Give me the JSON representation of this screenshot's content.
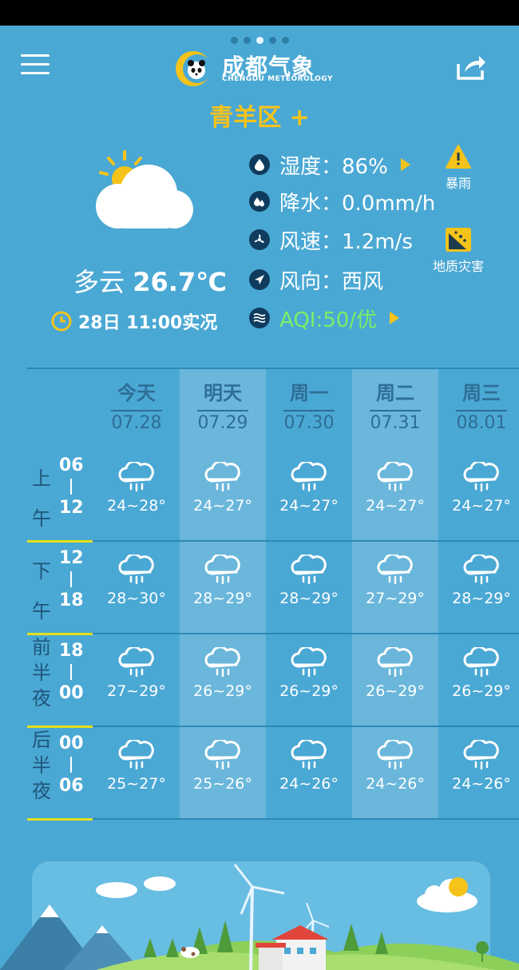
{
  "app": {
    "title": "成都气象",
    "subtitle": "CHENGDU METEOROLOGY"
  },
  "location": {
    "district": "青羊区 +"
  },
  "current": {
    "condition": "多云",
    "temperature": "26.7℃",
    "observed": "28日 11:00实况",
    "humidity": "湿度：86%",
    "precip": "降水：0.0mm/h",
    "wind_speed": "风速：1.2m/s",
    "wind_dir": "风向：西风",
    "aqi": "AQI:50/优"
  },
  "alerts": [
    {
      "label": "暴雨",
      "icon": "warning-icon",
      "color": "#f6c31a"
    },
    {
      "label": "地质灾害",
      "icon": "landslide-icon",
      "color": "#f6c31a"
    }
  ],
  "days": [
    {
      "name": "今天",
      "date": "07.28"
    },
    {
      "name": "明天",
      "date": "07.29"
    },
    {
      "name": "周一",
      "date": "07.30"
    },
    {
      "name": "周二",
      "date": "07.31"
    },
    {
      "name": "周三",
      "date": "08.01"
    }
  ],
  "periods": [
    {
      "label": [
        "上",
        "午"
      ],
      "start": "06",
      "end": "12",
      "temps": [
        "24~28°",
        "24~27°",
        "24~27°",
        "24~27°",
        "24~27°"
      ]
    },
    {
      "label": [
        "下",
        "午"
      ],
      "start": "12",
      "end": "18",
      "temps": [
        "28~30°",
        "28~29°",
        "28~29°",
        "27~29°",
        "28~29°"
      ]
    },
    {
      "label": [
        "前",
        "半",
        "夜"
      ],
      "start": "18",
      "end": "00",
      "temps": [
        "27~29°",
        "26~29°",
        "26~29°",
        "26~29°",
        "26~29°"
      ]
    },
    {
      "label": [
        "后",
        "半",
        "夜"
      ],
      "start": "00",
      "end": "06",
      "temps": [
        "25~27°",
        "25~26°",
        "24~26°",
        "24~26°",
        "24~26°"
      ]
    }
  ],
  "colors": {
    "background": "#4aa8d4",
    "accent": "#f6c31a",
    "aqi_good": "#7dee64"
  }
}
